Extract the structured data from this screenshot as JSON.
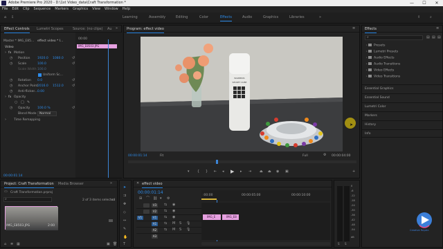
{
  "window": {
    "title": "Adobe Premiere Pro 2020 - D:\\1st Video_data\\Craft Transformation *",
    "controls": [
      "—",
      "☐",
      "✕"
    ]
  },
  "menu": [
    "File",
    "Edit",
    "Clip",
    "Sequence",
    "Markers",
    "Graphics",
    "View",
    "Window",
    "Help"
  ],
  "workspaces": {
    "items": [
      "Learning",
      "Assembly",
      "Editing",
      "Color",
      "Effects",
      "Audio",
      "Graphics",
      "Libraries"
    ],
    "active": "Effects"
  },
  "effect_controls": {
    "tabs": [
      "Effect Controls",
      "Lumetri Scopes",
      "Source: (no clips)",
      "Au"
    ],
    "master_label": "Master * IMG_E85...",
    "clip_label": "effect video * I...",
    "mini_timecode": "00:00",
    "mini_clip": "IMG_E8503.JPG",
    "video_header": "Video",
    "fx_motion": "Motion",
    "position_label": "Position",
    "position_x": "1920.0",
    "position_y": "1080.0",
    "scale_label": "Scale",
    "scale_value": "100.0",
    "scale_width_label": "Scale Width",
    "scale_width_value": "100.0",
    "uniform_scale_label": "Uniform Sc...",
    "rotation_label": "Rotation",
    "rotation_value": "0.0",
    "anchor_label": "Anchor Point",
    "anchor_x": "2016.0",
    "anchor_y": "1512.0",
    "antiflicker_label": "Anti-flicker...",
    "antiflicker_value": "0.00",
    "opacity_header": "Opacity",
    "opacity_label": "Opacity",
    "opacity_value": "100.0 %",
    "blend_label": "Blend Mode",
    "blend_value": "Normal",
    "time_remap": "Time Remapping",
    "timecode": "00:00:01:14"
  },
  "program": {
    "title": "Program: effect video",
    "timecode": "00:00:01:14",
    "fit": "Fit",
    "quality": "Full",
    "duration": "00:00:04:00",
    "image_label": "video frame: bottle, flowers, crystal dish with candies",
    "bottle_brand": "BARBERIS",
    "bottle_line1": "SECRET CUBE"
  },
  "project": {
    "tabs": [
      "Project: Craft Transformation",
      "Media Browser"
    ],
    "file": "Craft Transformation.prproj",
    "items_selected": "2 of 3 items selected",
    "thumb_name": "IMG_E8503.JPG",
    "thumb_duration": "2:00"
  },
  "timeline": {
    "tab": "effect video",
    "timecode": "00:00:01:14",
    "ruler": [
      ":00:00",
      "00:00:05:00",
      "00:00:10:00"
    ],
    "tracks": [
      "V3",
      "V2",
      "V1",
      "A1",
      "A2",
      "A3"
    ],
    "clip1": "IMG_E",
    "clip2": "IMG_E8"
  },
  "effects": {
    "title": "Effects",
    "folders": [
      "Presets",
      "Lumetri Presets",
      "Audio Effects",
      "Audio Transitions",
      "Video Effects",
      "Video Transitions"
    ],
    "sections": [
      "Essential Graphics",
      "Essential Sound",
      "Lumetri Color",
      "Markers",
      "History",
      "Info"
    ]
  },
  "audio_meter": {
    "scale": [
      "0",
      "-6",
      "-12",
      "-18",
      "-24",
      "-30",
      "-36",
      "-42",
      "-48",
      "-54",
      "dB"
    ],
    "solo": [
      "S",
      "S"
    ]
  },
  "logo": {
    "text": "Creative Royale"
  },
  "colors": {
    "accent": "#2d8ceb",
    "playhead": "#3c86d8",
    "clip_pink": "#e6a0e0",
    "track_on": "#2a5d96",
    "yellow_dot": "#b8a20f"
  }
}
